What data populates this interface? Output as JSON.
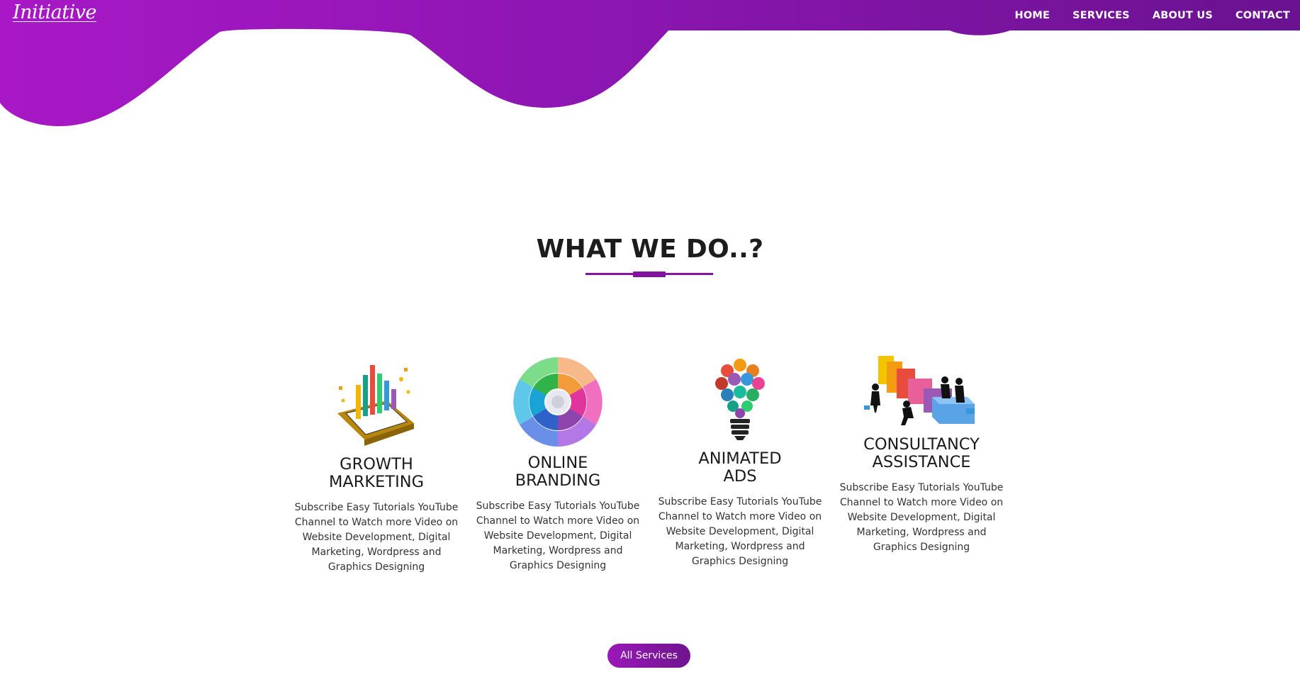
{
  "brand": {
    "logo_text": "Initiative"
  },
  "nav": {
    "links": [
      {
        "label": "HOME"
      },
      {
        "label": "SERVICES"
      },
      {
        "label": "ABOUT US"
      },
      {
        "label": "CONTACT"
      }
    ]
  },
  "section": {
    "title": "WHAT WE DO..?"
  },
  "services": [
    {
      "title": "GROWTH\nMARKETING",
      "icon": "growth-chart-icon",
      "description": "Subscribe Easy Tutorials YouTube Channel to Watch more Video on Website Development, Digital Marketing, Wordpress and Graphics Designing"
    },
    {
      "title": "ONLINE\nBRANDING",
      "icon": "branding-wheel-icon",
      "description": "Subscribe Easy Tutorials YouTube Channel to Watch more Video on Website Development, Digital Marketing, Wordpress and Graphics Designing"
    },
    {
      "title": "ANIMATED\nADS",
      "icon": "idea-bulb-icon",
      "description": "Subscribe Easy Tutorials YouTube Channel to Watch more Video on Website Development, Digital Marketing, Wordpress and Graphics Designing"
    },
    {
      "title": "CONSULTANCY\nASSISTANCE",
      "icon": "team-blocks-icon",
      "description": "Subscribe Easy Tutorials YouTube Channel to Watch more Video on Website Development, Digital Marketing, Wordpress and Graphics Designing"
    }
  ],
  "cta": {
    "label": "All Services"
  },
  "colors": {
    "accent": "#8413a0",
    "gradient_start": "#a418c4",
    "gradient_end": "#6a1290"
  }
}
